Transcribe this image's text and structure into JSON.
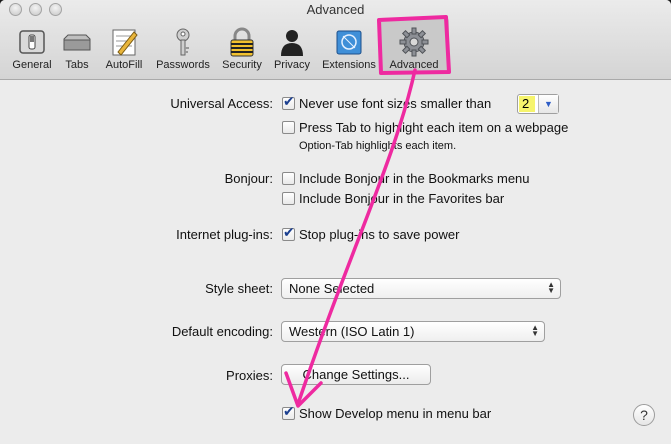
{
  "window": {
    "title": "Advanced"
  },
  "toolbar": {
    "items": [
      {
        "label": "General"
      },
      {
        "label": "Tabs"
      },
      {
        "label": "AutoFill"
      },
      {
        "label": "Passwords"
      },
      {
        "label": "Security"
      },
      {
        "label": "Privacy"
      },
      {
        "label": "Extensions"
      },
      {
        "label": "Advanced"
      }
    ],
    "selected": "Advanced"
  },
  "universal_access": {
    "label": "Universal Access:",
    "min_font_label": "Never use font sizes smaller than",
    "min_font_value": "2",
    "min_font_checked": true,
    "tab_label": "Press Tab to highlight each item on a webpage",
    "tab_checked": false,
    "tab_hint": "Option-Tab highlights each item."
  },
  "bonjour": {
    "label": "Bonjour:",
    "bookmarks_menu_label": "Include Bonjour in the Bookmarks menu",
    "bookmarks_menu_checked": false,
    "favorites_bar_label": "Include Bonjour in the Favorites bar",
    "favorites_bar_checked": false
  },
  "plugins": {
    "label": "Internet plug-ins:",
    "stop_label": "Stop plug-ins to save power",
    "stop_checked": true
  },
  "style_sheet": {
    "label": "Style sheet:",
    "value": "None Selected"
  },
  "encoding": {
    "label": "Default encoding:",
    "value": "Western (ISO Latin 1)"
  },
  "proxies": {
    "label": "Proxies:",
    "button_label": "Change Settings..."
  },
  "develop": {
    "label": "Show Develop menu in menu bar",
    "checked": true
  },
  "help": {
    "label": "?"
  },
  "colors": {
    "annotation": "#ee2aa0",
    "highlight": "#f6f46c",
    "checkmark": "#1b3f8f"
  }
}
